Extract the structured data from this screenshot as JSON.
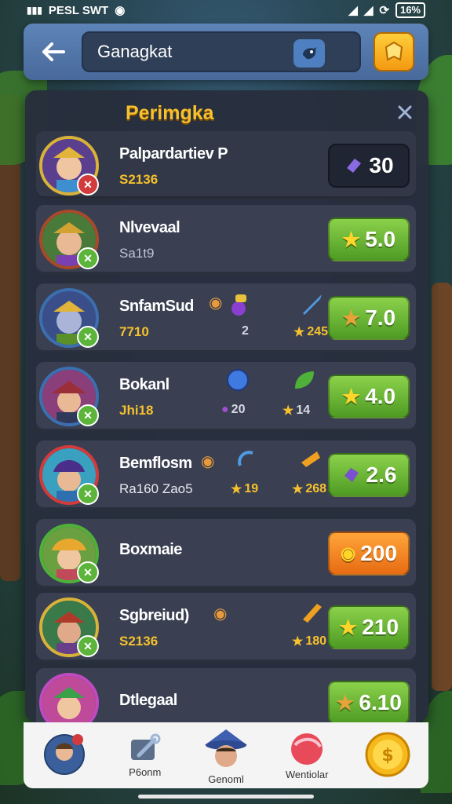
{
  "status_bar": {
    "left_text": "PESL SWT",
    "battery": "16%"
  },
  "topbar": {
    "search_value": "Ganagkat"
  },
  "panel": {
    "title": "Perimgka",
    "rows": [
      {
        "name": "Palpardartiev P",
        "sub": "S2136",
        "score": "30",
        "score_style": "dark",
        "score_icon": "gem-icon"
      },
      {
        "name": "Nlvevaal",
        "sub": "Sa1t9",
        "score": "5.0",
        "score_style": "green",
        "score_icon": "star-icon"
      },
      {
        "name": "SnfamSud",
        "sub": "7710",
        "stat1": "2",
        "stat2": "245",
        "score": "7.0",
        "score_style": "green",
        "score_icon": "star-icon"
      },
      {
        "name": "Bokanl",
        "sub": "Jhi18",
        "stat1": "20",
        "stat2": "14",
        "score": "4.0",
        "score_style": "green",
        "score_icon": "star-icon"
      },
      {
        "name": "Bemflosm",
        "sub": "Ra160 Zao5",
        "stat1": "19",
        "stat2": "268",
        "score": "2.6",
        "score_style": "green",
        "score_icon": "gem-icon"
      },
      {
        "name": "Boxmaie",
        "sub": "",
        "score": "200",
        "score_style": "orange",
        "score_icon": "coin-icon"
      },
      {
        "name": "Sgbreiud)",
        "sub": "S2136",
        "stat2": "180",
        "score": "210",
        "score_style": "green",
        "score_icon": "star-icon"
      },
      {
        "name": "Dtlegaal",
        "sub": "",
        "score": "6.10",
        "score_style": "green",
        "score_icon": "star-icon"
      }
    ]
  },
  "bottom_nav": [
    {
      "label": ""
    },
    {
      "label": "P6onm"
    },
    {
      "label": "Genoml"
    },
    {
      "label": "Wentiolar"
    },
    {
      "label": ""
    }
  ],
  "colors": {
    "accent_gold": "#f6c12c",
    "panel_bg": "#282e3c",
    "score_green": "#5aa92c",
    "score_orange": "#ef7e1e"
  }
}
